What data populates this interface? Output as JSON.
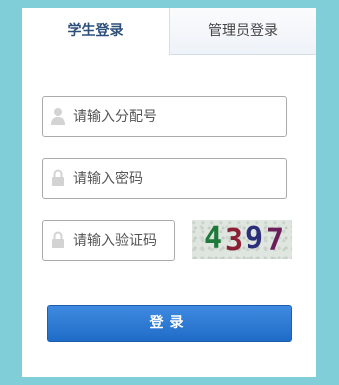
{
  "tabs": {
    "student_login": "学生登录",
    "admin_login": "管理员登录"
  },
  "form": {
    "assignment_number_placeholder": "请输入分配号",
    "password_placeholder": "请输入密码",
    "captcha_placeholder": "请输入验证码"
  },
  "captcha": {
    "digits": [
      "4",
      "3",
      "9",
      "7"
    ],
    "digit_colors": [
      "#1e7a3a",
      "#8a2035",
      "#2b2f7a",
      "#6a1f5a"
    ]
  },
  "login_button": {
    "label": "登录"
  },
  "icons": {
    "user": "user-icon",
    "lock": "lock-icon"
  },
  "colors": {
    "page_background": "#80cfd8",
    "button_primary": "#2a78d6",
    "active_tab_text": "#2d4f7c"
  }
}
